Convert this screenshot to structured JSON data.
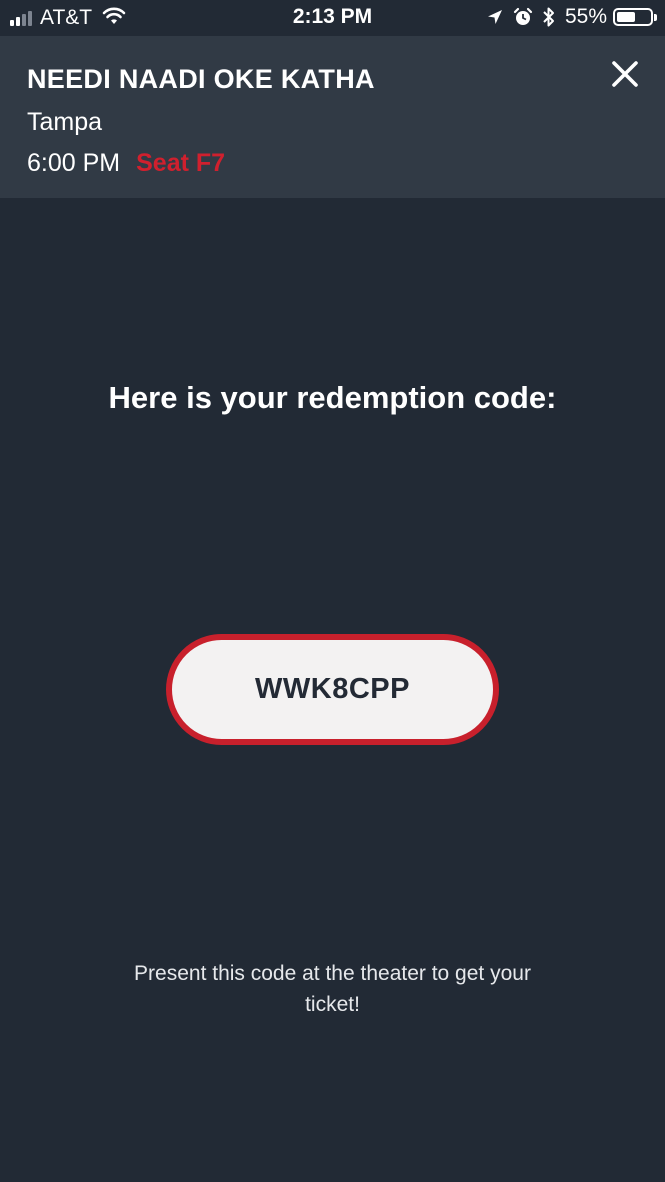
{
  "status_bar": {
    "carrier": "AT&T",
    "time": "2:13 PM",
    "battery_percent": "55%",
    "battery_level": 0.55,
    "icons": [
      "signal-icon",
      "wifi-icon",
      "location-icon",
      "alarm-icon",
      "bluetooth-icon",
      "battery-icon"
    ]
  },
  "header": {
    "movie_title": "NEEDI NAADI OKE KATHA",
    "location": "Tampa",
    "showtime": "6:00 PM",
    "seat": "Seat F7",
    "close_icon": "close-icon"
  },
  "main": {
    "heading": "Here is your redemption code:",
    "code": "WWK8CPP",
    "instructions": "Present this code at the theater to get your ticket!"
  },
  "colors": {
    "background": "#222a35",
    "header_background": "#313a45",
    "accent_red": "#c8202c",
    "code_background": "#f3f2f2"
  }
}
